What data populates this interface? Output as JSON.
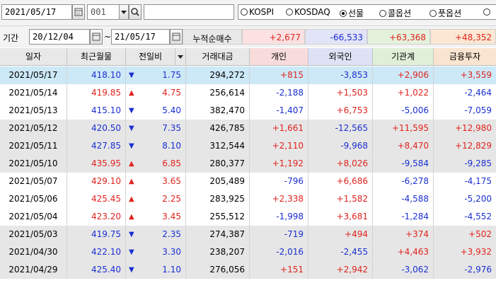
{
  "toolbar": {
    "date": "2021/05/17",
    "code": "001",
    "name_value": "",
    "markets": [
      {
        "label": "KOSPI",
        "selected": false
      },
      {
        "label": "KOSDAQ",
        "selected": false
      },
      {
        "label": "선물",
        "selected": true
      },
      {
        "label": "콜옵션",
        "selected": false
      },
      {
        "label": "풋옵션",
        "selected": false
      }
    ]
  },
  "filters": {
    "period_label": "기간",
    "start_date": "20/12/04",
    "tilde": "~",
    "end_date": "21/05/17",
    "cum_label": "누적순매수",
    "cum_values": [
      "+2,677",
      "-66,533",
      "+63,368",
      "+48,352"
    ]
  },
  "table": {
    "headers": [
      "일자",
      "최근월물",
      "전일비",
      "거래대금",
      "개인",
      "외국인",
      "기관계",
      "금융투자"
    ],
    "rows": [
      {
        "date": "2021/05/17",
        "price": "418.10",
        "dir": "down",
        "change": "1.75",
        "amount": "294,272",
        "ind": "+815",
        "frn": "-3,853",
        "inst": "+2,906",
        "fin": "+3,559"
      },
      {
        "date": "2021/05/14",
        "price": "419.85",
        "dir": "up",
        "change": "4.75",
        "amount": "256,614",
        "ind": "-2,188",
        "frn": "+1,503",
        "inst": "+1,022",
        "fin": "-2,464"
      },
      {
        "date": "2021/05/13",
        "price": "415.10",
        "dir": "down",
        "change": "5.40",
        "amount": "382,470",
        "ind": "-1,407",
        "frn": "+6,753",
        "inst": "-5,006",
        "fin": "-7,059"
      },
      {
        "date": "2021/05/12",
        "price": "420.50",
        "dir": "down",
        "change": "7.35",
        "amount": "426,785",
        "ind": "+1,661",
        "frn": "-12,565",
        "inst": "+11,595",
        "fin": "+12,980"
      },
      {
        "date": "2021/05/11",
        "price": "427.85",
        "dir": "down",
        "change": "8.10",
        "amount": "312,544",
        "ind": "+2,110",
        "frn": "-9,968",
        "inst": "+8,470",
        "fin": "+12,829"
      },
      {
        "date": "2021/05/10",
        "price": "435.95",
        "dir": "up",
        "change": "6.85",
        "amount": "280,377",
        "ind": "+1,192",
        "frn": "+8,026",
        "inst": "-9,584",
        "fin": "-9,285"
      },
      {
        "date": "2021/05/07",
        "price": "429.10",
        "dir": "up",
        "change": "3.65",
        "amount": "205,489",
        "ind": "-796",
        "frn": "+6,686",
        "inst": "-6,278",
        "fin": "-4,175"
      },
      {
        "date": "2021/05/06",
        "price": "425.45",
        "dir": "up",
        "change": "2.25",
        "amount": "283,925",
        "ind": "+2,338",
        "frn": "+1,582",
        "inst": "-4,588",
        "fin": "-5,200"
      },
      {
        "date": "2021/05/04",
        "price": "423.20",
        "dir": "up",
        "change": "3.45",
        "amount": "255,512",
        "ind": "-1,998",
        "frn": "+3,681",
        "inst": "-1,284",
        "fin": "-4,552"
      },
      {
        "date": "2021/05/03",
        "price": "419.75",
        "dir": "down",
        "change": "2.35",
        "amount": "274,387",
        "ind": "-719",
        "frn": "+494",
        "inst": "+374",
        "fin": "+502"
      },
      {
        "date": "2021/04/30",
        "price": "422.10",
        "dir": "down",
        "change": "3.30",
        "amount": "238,207",
        "ind": "-2,016",
        "frn": "-2,455",
        "inst": "+4,463",
        "fin": "+3,932"
      },
      {
        "date": "2021/04/29",
        "price": "425.40",
        "dir": "down",
        "change": "1.10",
        "amount": "276,056",
        "ind": "+151",
        "frn": "+2,942",
        "inst": "-3,062",
        "fin": "-2,976"
      }
    ]
  },
  "colors": {
    "up": "#e0231e",
    "down": "#1a2fd0",
    "selected_row": "#cde8f6",
    "shaded_row": "#e6e6e6",
    "cum_ind_bg": "#fbe1e1",
    "cum_frn_bg": "#e2e4f8",
    "cum_inst_bg": "#e4f2dc",
    "cum_fin_bg": "#fbe7d3"
  },
  "icons": [
    "calendar-icon",
    "dropdown-arrow-icon",
    "search-icon",
    "sort-dropdown-icon",
    "triangle-up-icon",
    "triangle-down-icon"
  ]
}
